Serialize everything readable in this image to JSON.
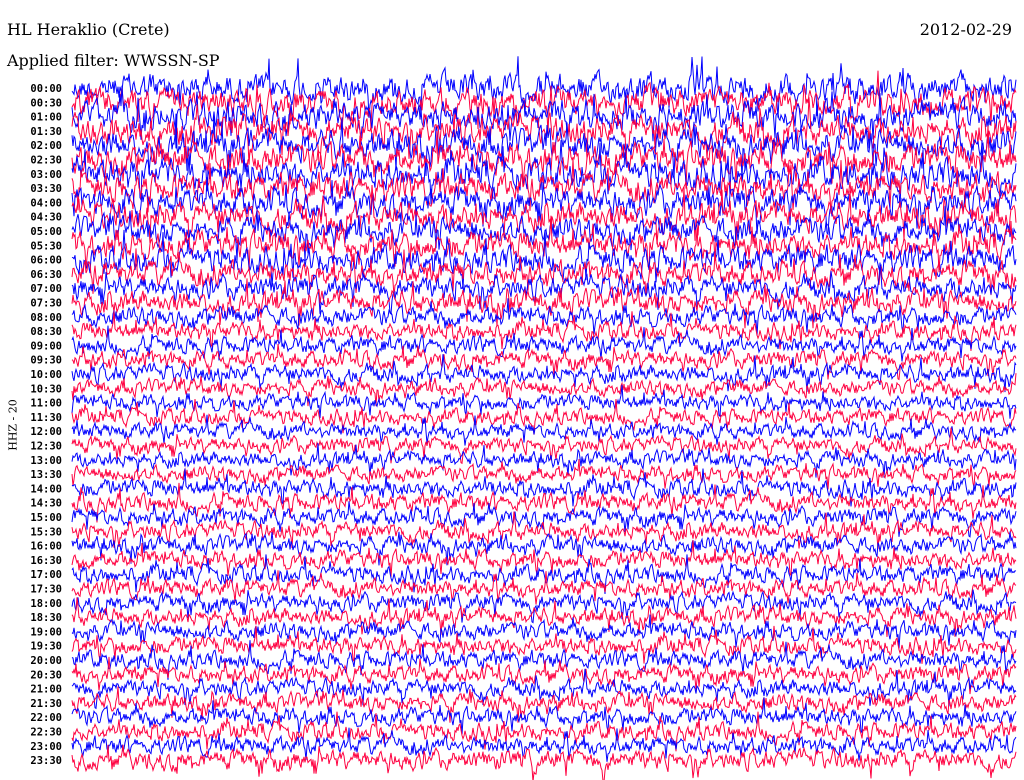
{
  "header": {
    "station": "HL Heraklio (Crete)",
    "date": "2012-02-29",
    "filter": "Applied filter: WWSSN-SP"
  },
  "chart_data": {
    "type": "line",
    "title": "HL Heraklio (Crete)",
    "subtitle": "Applied filter: WWSSN-SP",
    "ylabel": "HHZ - 20",
    "xlabel": "",
    "colors": [
      "#0000ff",
      "#ff0040"
    ],
    "row_labels": [
      "00:00",
      "00:30",
      "01:00",
      "01:30",
      "02:00",
      "02:30",
      "03:00",
      "03:30",
      "04:00",
      "04:30",
      "05:00",
      "05:30",
      "06:00",
      "06:30",
      "07:00",
      "07:30",
      "08:00",
      "08:30",
      "09:00",
      "09:30",
      "10:00",
      "10:30",
      "11:00",
      "11:30",
      "12:00",
      "12:30",
      "13:00",
      "13:30",
      "14:00",
      "14:30",
      "15:00",
      "15:30",
      "16:00",
      "16:30",
      "17:00",
      "17:30",
      "18:00",
      "18:30",
      "19:00",
      "19:30",
      "20:00",
      "20:30",
      "21:00",
      "21:30",
      "22:00",
      "22:30",
      "23:00",
      "23:30"
    ],
    "relative_amplitude": [
      1.6,
      1.6,
      1.6,
      1.7,
      1.7,
      1.7,
      1.7,
      1.6,
      1.6,
      1.6,
      1.5,
      1.5,
      1.5,
      1.4,
      1.3,
      1.3,
      1.1,
      1.0,
      1.0,
      1.0,
      1.0,
      0.9,
      0.9,
      0.9,
      0.9,
      0.9,
      0.9,
      0.9,
      1.0,
      1.0,
      1.0,
      1.0,
      1.0,
      1.0,
      1.0,
      1.0,
      1.0,
      1.0,
      1.0,
      1.0,
      1.0,
      1.0,
      1.0,
      1.0,
      1.0,
      1.0,
      1.0,
      1.1
    ],
    "grid": false
  }
}
